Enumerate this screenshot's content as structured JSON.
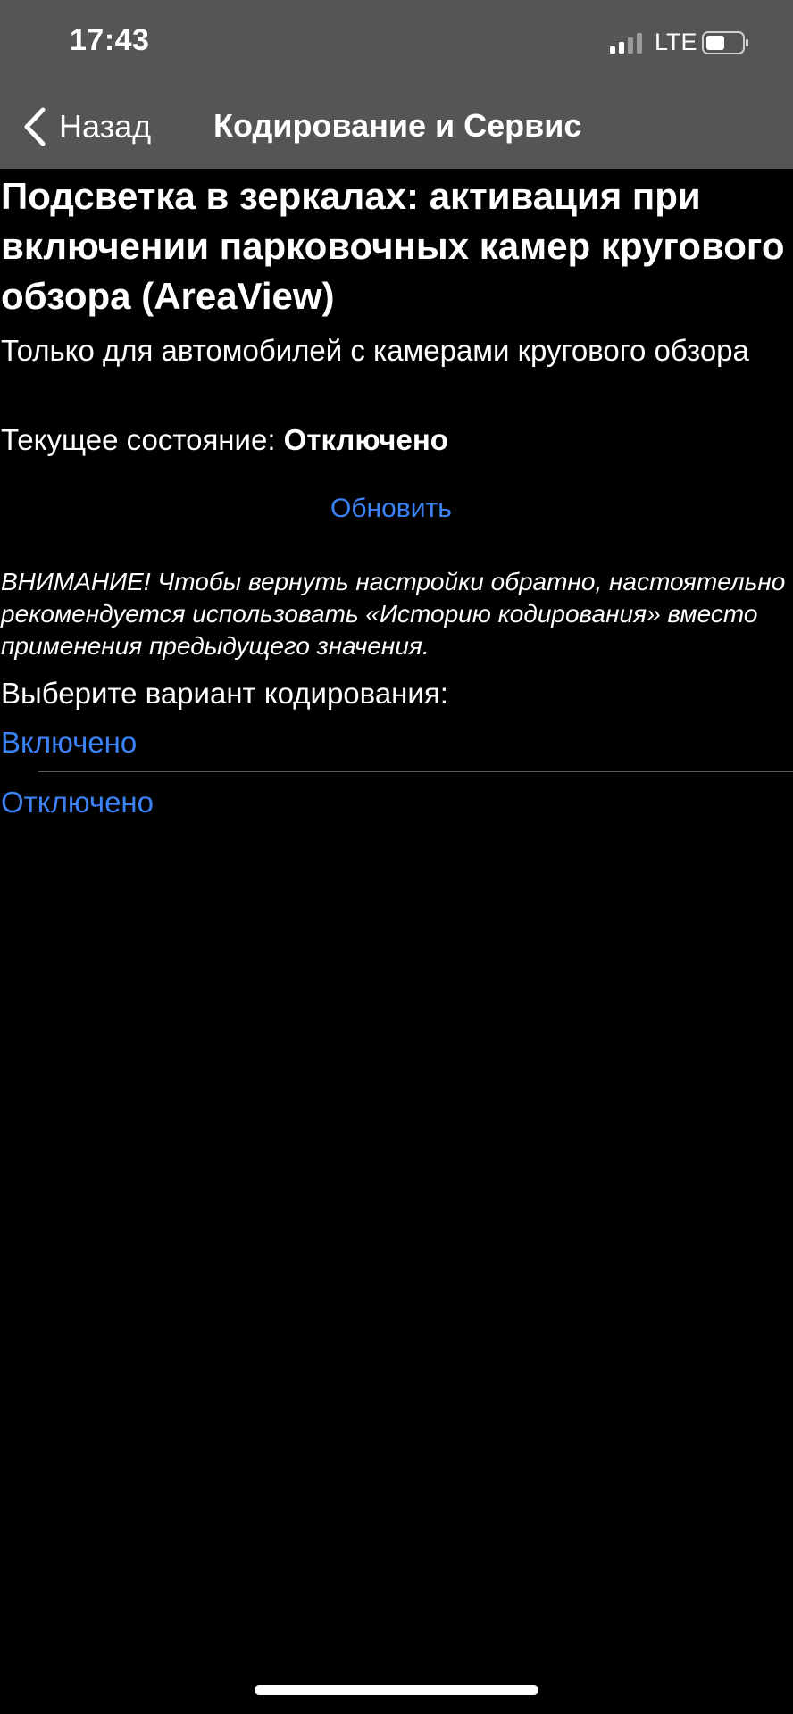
{
  "status_bar": {
    "time": "17:43",
    "network": "LTE"
  },
  "nav": {
    "back_label": "Назад",
    "title": "Кодирование и Сервис"
  },
  "setting": {
    "title": "Подсветка в зеркалах: активация при включении парковочных камер кругового обзора (AreaView)",
    "subtitle": "Только для автомобилей с камерами кругового обзора",
    "state_label": "Текущее состояние: ",
    "state_value": "Отключено",
    "refresh_label": "Обновить",
    "warning": "ВНИМАНИЕ! Чтобы вернуть настройки обратно, настоятельно рекомендуется использовать «Историю кодирования» вместо применения предыдущего значения.",
    "choose_label": "Выберите вариант кодирования:",
    "options": [
      {
        "label": "Включено"
      },
      {
        "label": "Отключено"
      }
    ]
  },
  "colors": {
    "header_bg": "#555555",
    "background": "#000000",
    "accent": "#3b82f6",
    "text": "#ffffff"
  }
}
